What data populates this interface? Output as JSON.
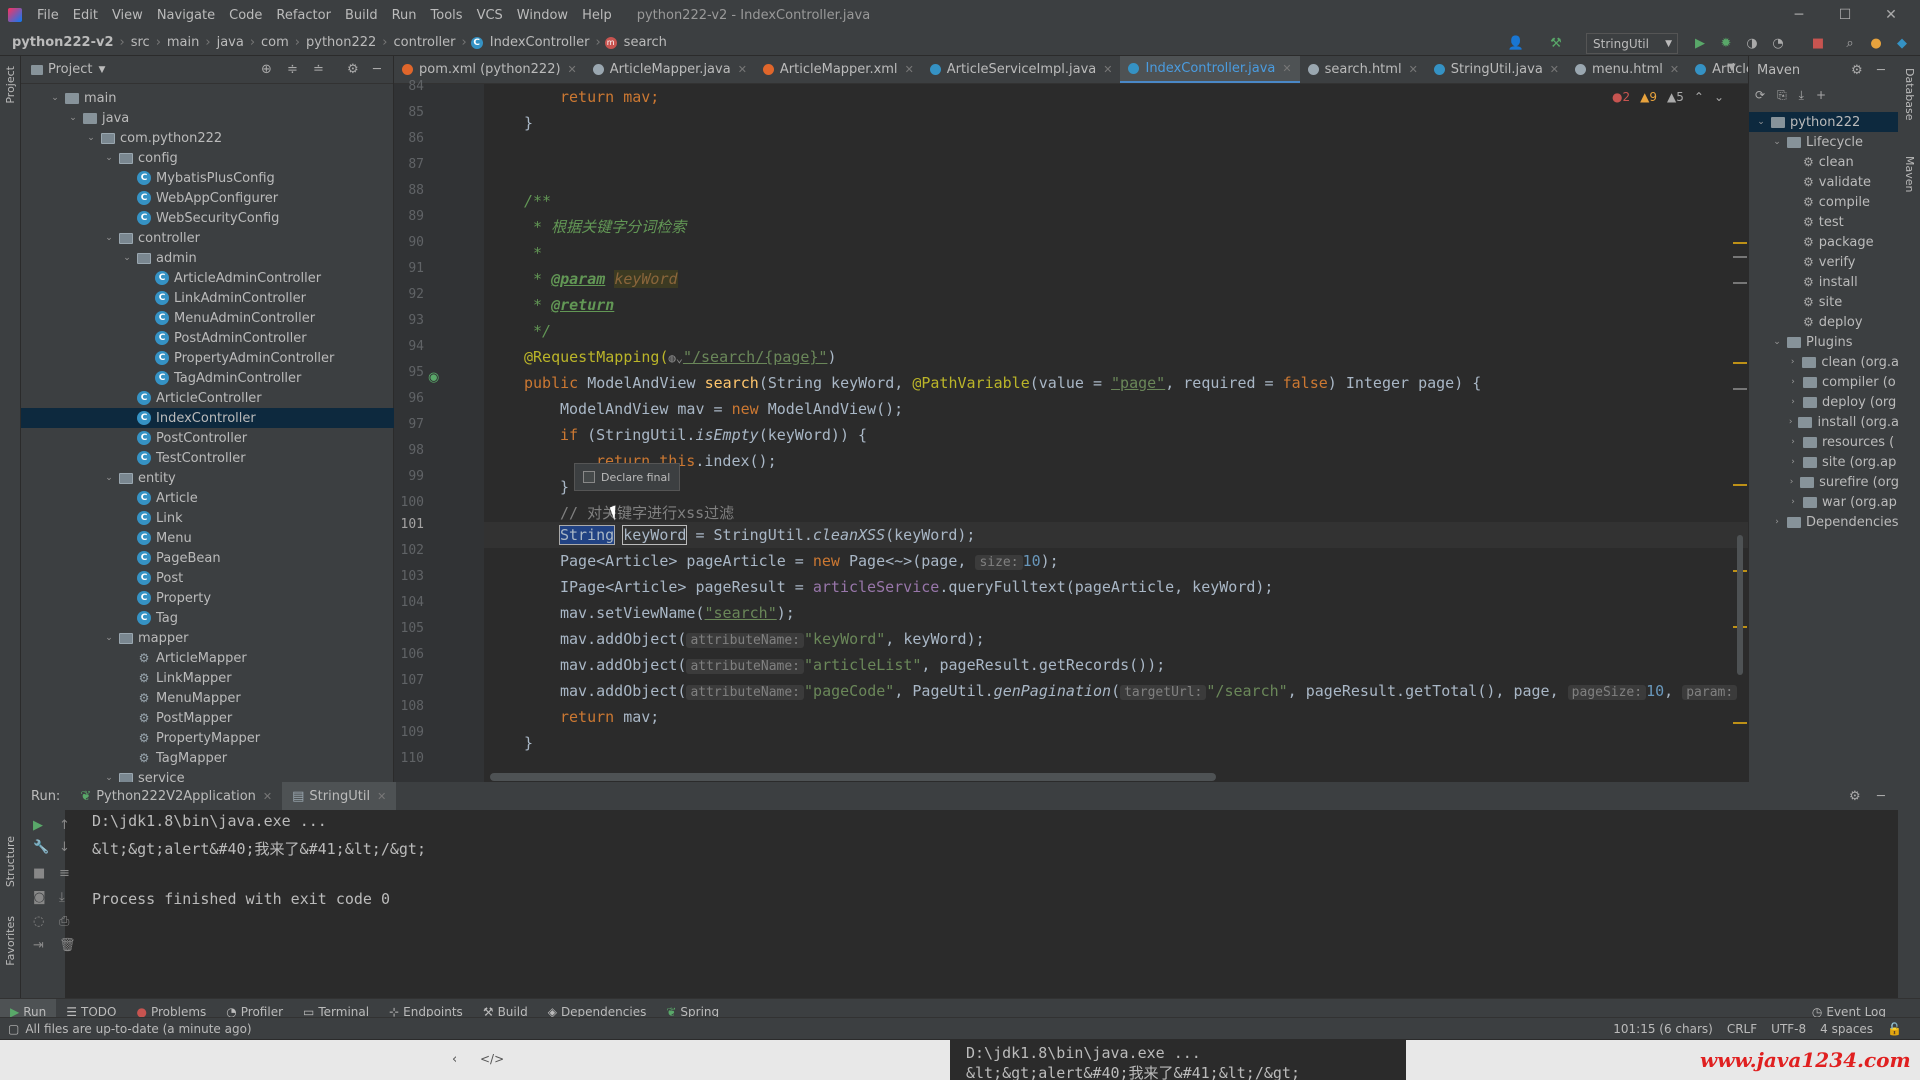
{
  "menubar": {
    "items": [
      "File",
      "Edit",
      "View",
      "Navigate",
      "Code",
      "Refactor",
      "Build",
      "Run",
      "Tools",
      "VCS",
      "Window",
      "Help"
    ],
    "title": "python222-v2 - IndexController.java"
  },
  "breadcrumb": [
    "python222-v2",
    "src",
    "main",
    "java",
    "com",
    "python222",
    "controller",
    "IndexController",
    "search"
  ],
  "run_config": "StringUtil",
  "project": {
    "title": "Project",
    "tree": [
      {
        "label": "main",
        "depth": 2,
        "type": "folder",
        "arrow": "open"
      },
      {
        "label": "java",
        "depth": 3,
        "type": "folder",
        "arrow": "open"
      },
      {
        "label": "com.python222",
        "depth": 4,
        "type": "pkg",
        "arrow": "open"
      },
      {
        "label": "config",
        "depth": 5,
        "type": "pkg",
        "arrow": "open"
      },
      {
        "label": "MybatisPlusConfig",
        "depth": 6,
        "type": "cls"
      },
      {
        "label": "WebAppConfigurer",
        "depth": 6,
        "type": "cls"
      },
      {
        "label": "WebSecurityConfig",
        "depth": 6,
        "type": "cls"
      },
      {
        "label": "controller",
        "depth": 5,
        "type": "pkg",
        "arrow": "open"
      },
      {
        "label": "admin",
        "depth": 6,
        "type": "pkg",
        "arrow": "open"
      },
      {
        "label": "ArticleAdminController",
        "depth": 7,
        "type": "cls"
      },
      {
        "label": "LinkAdminController",
        "depth": 7,
        "type": "cls"
      },
      {
        "label": "MenuAdminController",
        "depth": 7,
        "type": "cls"
      },
      {
        "label": "PostAdminController",
        "depth": 7,
        "type": "cls"
      },
      {
        "label": "PropertyAdminController",
        "depth": 7,
        "type": "cls"
      },
      {
        "label": "TagAdminController",
        "depth": 7,
        "type": "cls"
      },
      {
        "label": "ArticleController",
        "depth": 6,
        "type": "cls"
      },
      {
        "label": "IndexController",
        "depth": 6,
        "type": "cls",
        "selected": true
      },
      {
        "label": "PostController",
        "depth": 6,
        "type": "cls"
      },
      {
        "label": "TestController",
        "depth": 6,
        "type": "cls"
      },
      {
        "label": "entity",
        "depth": 5,
        "type": "pkg",
        "arrow": "open"
      },
      {
        "label": "Article",
        "depth": 6,
        "type": "cls"
      },
      {
        "label": "Link",
        "depth": 6,
        "type": "cls"
      },
      {
        "label": "Menu",
        "depth": 6,
        "type": "cls"
      },
      {
        "label": "PageBean",
        "depth": 6,
        "type": "cls"
      },
      {
        "label": "Post",
        "depth": 6,
        "type": "cls"
      },
      {
        "label": "Property",
        "depth": 6,
        "type": "cls"
      },
      {
        "label": "Tag",
        "depth": 6,
        "type": "cls"
      },
      {
        "label": "mapper",
        "depth": 5,
        "type": "pkg",
        "arrow": "open"
      },
      {
        "label": "ArticleMapper",
        "depth": 6,
        "type": "mapper"
      },
      {
        "label": "LinkMapper",
        "depth": 6,
        "type": "mapper"
      },
      {
        "label": "MenuMapper",
        "depth": 6,
        "type": "mapper"
      },
      {
        "label": "PostMapper",
        "depth": 6,
        "type": "mapper"
      },
      {
        "label": "PropertyMapper",
        "depth": 6,
        "type": "mapper"
      },
      {
        "label": "TagMapper",
        "depth": 6,
        "type": "mapper"
      },
      {
        "label": "service",
        "depth": 5,
        "type": "pkg",
        "arrow": "open"
      }
    ]
  },
  "tabs": [
    {
      "label": "pom.xml (python222)",
      "color": "#e0662b"
    },
    {
      "label": "ArticleMapper.java",
      "color": "#9aa7b0"
    },
    {
      "label": "ArticleMapper.xml",
      "color": "#e0662b"
    },
    {
      "label": "ArticleServiceImpl.java",
      "color": "#3592c4"
    },
    {
      "label": "IndexController.java",
      "color": "#3592c4",
      "active": true
    },
    {
      "label": "search.html",
      "color": "#9aa7b0"
    },
    {
      "label": "StringUtil.java",
      "color": "#3592c4"
    },
    {
      "label": "menu.html",
      "color": "#9aa7b0"
    },
    {
      "label": "ArticleController.ja",
      "color": "#3592c4"
    }
  ],
  "inspections": {
    "errors": "2",
    "warnings": "9",
    "weak": "5"
  },
  "line_numbers": [
    "84",
    "85",
    "86",
    "87",
    "88",
    "89",
    "90",
    "91",
    "92",
    "93",
    "94",
    "95",
    "96",
    "97",
    "98",
    "99",
    "100",
    "101",
    "102",
    "103",
    "104",
    "105",
    "106",
    "107",
    "108",
    "109",
    "110"
  ],
  "current_line": "101",
  "code": {
    "l84": "return mav;",
    "l85": "}",
    "l88": "/**",
    "l89": " * 根据关键字分词检索",
    "l90": " *",
    "l91a": " * ",
    "l91b": "@param",
    "l91c": "keyWord",
    "l92a": " * ",
    "l92b": "@return",
    "l93": " */",
    "l94a": "@RequestMapping(",
    "l94b": "\"/search/{page}\"",
    "l94c": ")",
    "l95a": "public ",
    "l95b": "ModelAndView ",
    "l95c": "search",
    "l95d": "(String keyWord, ",
    "l95e": "@PathVariable",
    "l95f": "(value = ",
    "l95g": "\"page\"",
    "l95h": ", required = ",
    "l95i": "false",
    "l95j": ") Integer page) {",
    "l96a": "ModelAndView mav = ",
    "l96b": "new ",
    "l96c": "ModelAndView();",
    "l97a": "if ",
    "l97b": "(StringUtil.",
    "l97c": "isEmpty",
    "l97d": "(keyWord)) {",
    "l98a": "return ",
    "l98b": "this",
    "l98c": ".index();",
    "l99": "}",
    "l100": "// 对关键字进行xss过滤",
    "l101a": "String",
    "l101b": "keyWord",
    "l101c": " = StringUtil.",
    "l101d": "cleanXSS",
    "l101e": "(keyWord);",
    "l102a": "Page<Article> pageArticle = ",
    "l102b": "new ",
    "l102c": "Page<~>(page, ",
    "l102d": "size:",
    "l102e": "10",
    "l102f": ");",
    "l103a": "IPage<Article> pageResult = ",
    "l103b": "articleService",
    "l103c": ".queryFulltext(pageArticle, keyWord);",
    "l104a": "mav.setViewName(",
    "l104b": "\"search\"",
    "l104c": ");",
    "l105a": "mav.addObject(",
    "l105b": "attributeName:",
    "l105c": "\"keyWord\"",
    "l105d": ", keyWord);",
    "l106a": "mav.addObject(",
    "l106b": "attributeName:",
    "l106c": "\"articleList\"",
    "l106d": ", pageResult.getRecords());",
    "l107a": "mav.addObject(",
    "l107b": "attributeName:",
    "l107c": "\"pageCode\"",
    "l107d": ", PageUtil.",
    "l107e": "genPagination",
    "l107f": "(",
    "l107g": "targetUrl:",
    "l107h": "\"/search\"",
    "l107i": ", pageResult.getTotal(), page, ",
    "l107j": "pageSize:",
    "l107k": "10",
    "l107l": ", ",
    "l107m": "param:",
    "l108a": "return ",
    "l108b": "mav;",
    "l109": "}"
  },
  "popup": {
    "label": "Declare final"
  },
  "maven": {
    "title": "Maven",
    "rows": [
      {
        "label": "python222",
        "depth": 0,
        "arrow": "open"
      },
      {
        "label": "Lifecycle",
        "depth": 1,
        "arrow": "open"
      },
      {
        "label": "clean",
        "depth": 2,
        "gear": true
      },
      {
        "label": "validate",
        "depth": 2,
        "gear": true
      },
      {
        "label": "compile",
        "depth": 2,
        "gear": true
      },
      {
        "label": "test",
        "depth": 2,
        "gear": true
      },
      {
        "label": "package",
        "depth": 2,
        "gear": true
      },
      {
        "label": "verify",
        "depth": 2,
        "gear": true
      },
      {
        "label": "install",
        "depth": 2,
        "gear": true
      },
      {
        "label": "site",
        "depth": 2,
        "gear": true
      },
      {
        "label": "deploy",
        "depth": 2,
        "gear": true
      },
      {
        "label": "Plugins",
        "depth": 1,
        "arrow": "open"
      },
      {
        "label": "clean (org.a",
        "depth": 2,
        "arrow": "closed"
      },
      {
        "label": "compiler (o",
        "depth": 2,
        "arrow": "closed"
      },
      {
        "label": "deploy (org",
        "depth": 2,
        "arrow": "closed"
      },
      {
        "label": "install (org.a",
        "depth": 2,
        "arrow": "closed"
      },
      {
        "label": "resources (",
        "depth": 2,
        "arrow": "closed"
      },
      {
        "label": "site (org.ap",
        "depth": 2,
        "arrow": "closed"
      },
      {
        "label": "surefire (org",
        "depth": 2,
        "arrow": "closed"
      },
      {
        "label": "war (org.ap",
        "depth": 2,
        "arrow": "closed"
      },
      {
        "label": "Dependencies",
        "depth": 1,
        "arrow": "closed"
      }
    ]
  },
  "run": {
    "label": "Run:",
    "tabs": [
      "Python222V2Application",
      "StringUtil"
    ],
    "console": [
      "D:\\jdk1.8\\bin\\java.exe ...",
      "&lt;&gt;alert&#40;我来了&#41;&lt;/&gt;",
      "",
      "Process finished with exit code 0"
    ]
  },
  "bottom_tabs": [
    "Run",
    "TODO",
    "Problems",
    "Profiler",
    "Terminal",
    "Endpoints",
    "Build",
    "Dependencies",
    "Spring"
  ],
  "event_log": "Event Log",
  "status": {
    "message": "All files are up-to-date (a minute ago)",
    "position": "101:15 (6 chars)",
    "line_sep": "CRLF",
    "encoding": "UTF-8",
    "indent": "4 spaces"
  },
  "side_labels": {
    "project": "Project",
    "structure": "Structure",
    "favorites": "Favorites",
    "database": "Database",
    "maven": "Maven"
  },
  "below": {
    "term1": "D:\\jdk1.8\\bin\\java.exe ...",
    "term2": "&lt;&gt;alert&#40;我来了&#41;&lt;/&gt;",
    "watermark": "www.java1234.com"
  }
}
